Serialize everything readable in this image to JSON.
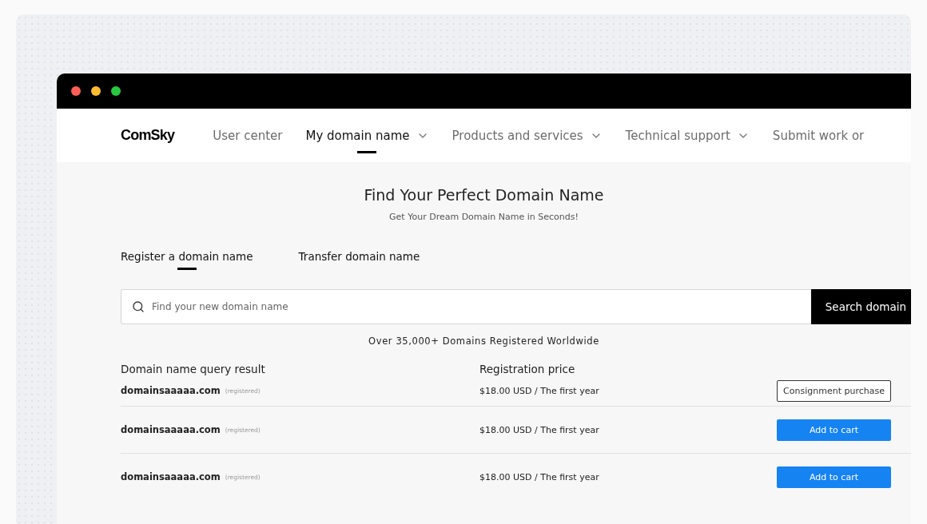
{
  "logo": "ComSky",
  "nav": [
    {
      "label": "User center",
      "selected": false,
      "has_menu": false
    },
    {
      "label": "My domain name",
      "selected": true,
      "has_menu": true
    },
    {
      "label": "Products and services",
      "selected": false,
      "has_menu": true
    },
    {
      "label": "Technical support",
      "selected": false,
      "has_menu": true
    },
    {
      "label": "Submit work or",
      "selected": false,
      "has_menu": false
    }
  ],
  "hero": {
    "title": "Find Your Perfect Domain Name",
    "subtitle": "Get Your Dream Domain Name in Seconds!"
  },
  "tabs": [
    {
      "label": "Register a domain name",
      "selected": true
    },
    {
      "label": "Transfer domain name",
      "selected": false
    }
  ],
  "search": {
    "placeholder": "Find your new domain name",
    "button": "Search domain"
  },
  "stat": "Over 35,000+ Domains Registered Worldwide",
  "table": {
    "columns": [
      "Domain name query result",
      "Registration price"
    ],
    "rows": [
      {
        "domain": "domainsaaaaa.com",
        "status": "(registered)",
        "price": "$18.00 USD / The first year",
        "action": {
          "kind": "outline",
          "label": "Consignment purchase"
        }
      },
      {
        "domain": "domainsaaaaa.com",
        "status": "(registered)",
        "price": "$18.00 USD / The first year",
        "action": {
          "kind": "primary",
          "label": "Add to cart"
        }
      },
      {
        "domain": "domainsaaaaa.com",
        "status": "(registered)",
        "price": "$18.00 USD / The first year",
        "action": {
          "kind": "primary",
          "label": "Add to cart"
        }
      }
    ]
  }
}
